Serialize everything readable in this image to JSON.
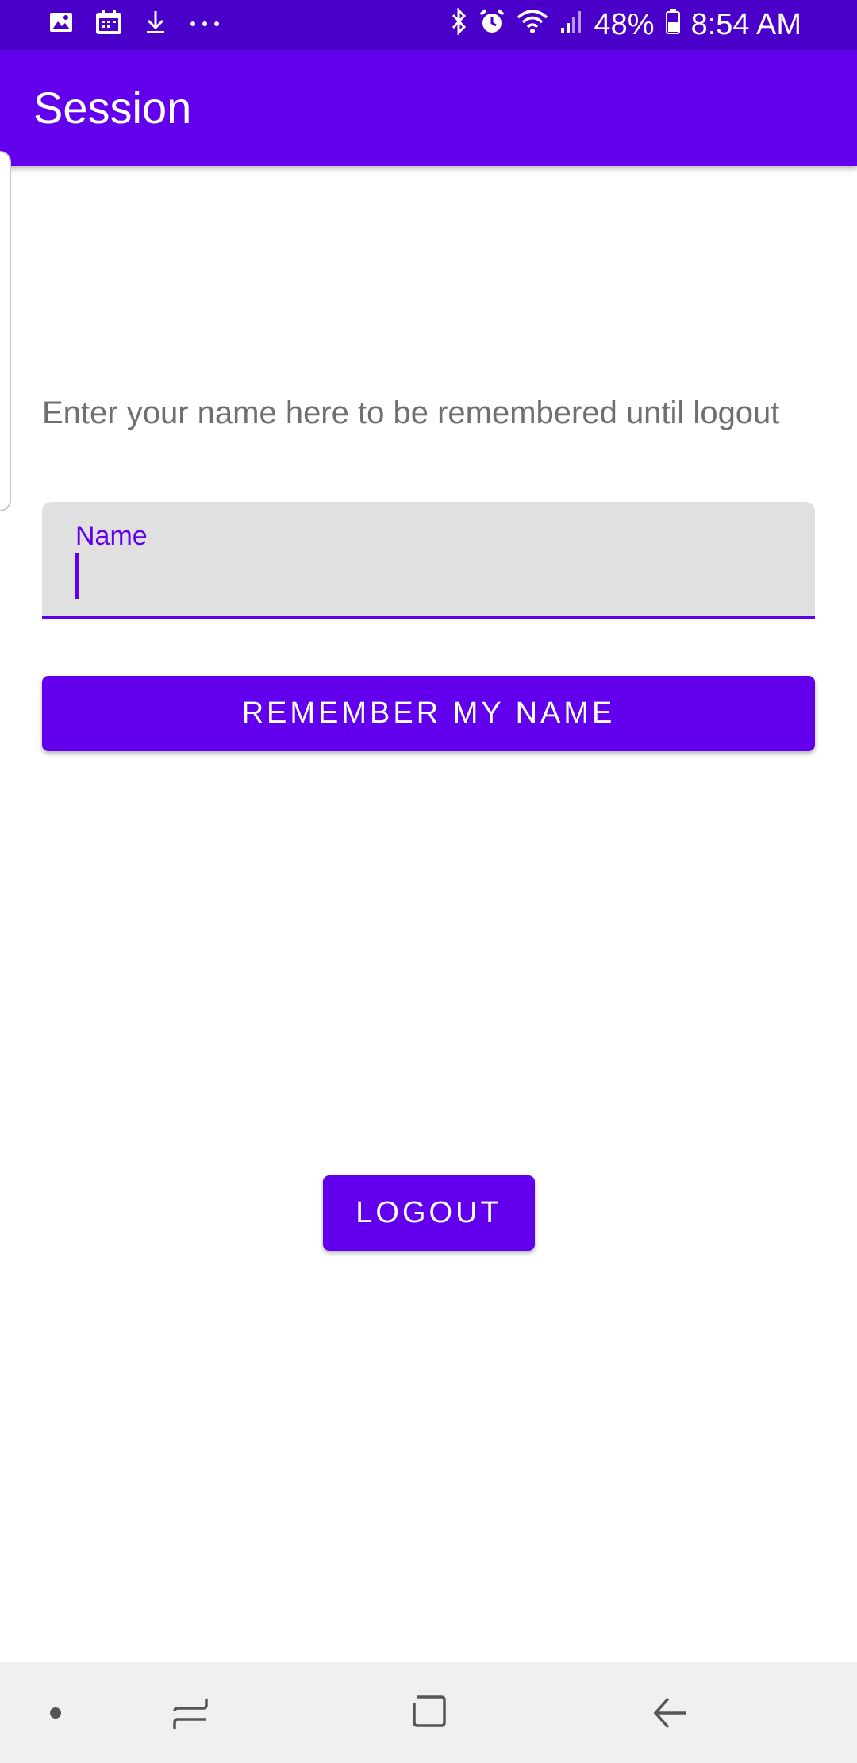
{
  "status_bar": {
    "left_icons": [
      "image-icon",
      "calendar-icon",
      "download-icon",
      "more-dots-icon"
    ],
    "right_icons": [
      "bluetooth-icon",
      "alarm-icon",
      "wifi-icon",
      "signal-icon",
      "battery-icon"
    ],
    "battery": "48%",
    "time": "8:54 AM"
  },
  "app_bar": {
    "title": "Session"
  },
  "main": {
    "prompt": "Enter your name here to be remembered until logout",
    "name_field": {
      "label": "Name",
      "value": ""
    },
    "remember_button": "Remember my name",
    "logout_button": "Logout"
  },
  "nav_bar": {
    "items": [
      "dot-icon",
      "recents-icon",
      "home-icon",
      "back-icon"
    ]
  },
  "colors": {
    "primary": "#6200ee",
    "status_bar": "#4a00c8",
    "field_bg": "#e0e0e0"
  }
}
